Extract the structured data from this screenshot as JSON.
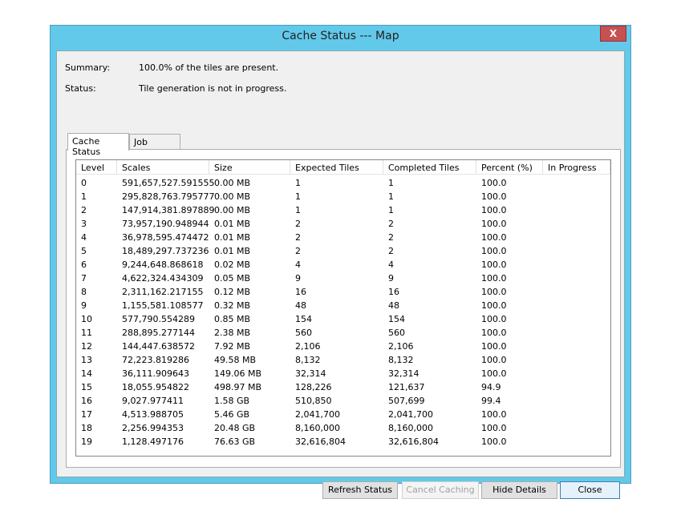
{
  "window": {
    "title": "Cache Status --- Map",
    "close_label": "X"
  },
  "summary": {
    "label": "Summary:",
    "value": "100.0% of the tiles are present."
  },
  "status": {
    "label": "Status:",
    "value": "Tile generation is not in progress."
  },
  "tabs": [
    {
      "label": "Cache Status",
      "active": true
    },
    {
      "label": "Job Status",
      "active": false
    }
  ],
  "table": {
    "columns": [
      "Level",
      "Scales",
      "Size",
      "Expected Tiles",
      "Completed Tiles",
      "Percent (%)",
      "In Progress"
    ],
    "rows": [
      [
        "0",
        "591,657,527.591555",
        "0.00 MB",
        "1",
        "1",
        "100.0",
        ""
      ],
      [
        "1",
        "295,828,763.795777",
        "0.00 MB",
        "1",
        "1",
        "100.0",
        ""
      ],
      [
        "2",
        "147,914,381.897889",
        "0.00 MB",
        "1",
        "1",
        "100.0",
        ""
      ],
      [
        "3",
        "73,957,190.948944",
        "0.01 MB",
        "2",
        "2",
        "100.0",
        ""
      ],
      [
        "4",
        "36,978,595.474472",
        "0.01 MB",
        "2",
        "2",
        "100.0",
        ""
      ],
      [
        "5",
        "18,489,297.737236",
        "0.01 MB",
        "2",
        "2",
        "100.0",
        ""
      ],
      [
        "6",
        "9,244,648.868618",
        "0.02 MB",
        "4",
        "4",
        "100.0",
        ""
      ],
      [
        "7",
        "4,622,324.434309",
        "0.05 MB",
        "9",
        "9",
        "100.0",
        ""
      ],
      [
        "8",
        "2,311,162.217155",
        "0.12 MB",
        "16",
        "16",
        "100.0",
        ""
      ],
      [
        "9",
        "1,155,581.108577",
        "0.32 MB",
        "48",
        "48",
        "100.0",
        ""
      ],
      [
        "10",
        "577,790.554289",
        "0.85 MB",
        "154",
        "154",
        "100.0",
        ""
      ],
      [
        "11",
        "288,895.277144",
        "2.38 MB",
        "560",
        "560",
        "100.0",
        ""
      ],
      [
        "12",
        "144,447.638572",
        "7.92 MB",
        "2,106",
        "2,106",
        "100.0",
        ""
      ],
      [
        "13",
        "72,223.819286",
        "49.58 MB",
        "8,132",
        "8,132",
        "100.0",
        ""
      ],
      [
        "14",
        "36,111.909643",
        "149.06 MB",
        "32,314",
        "32,314",
        "100.0",
        ""
      ],
      [
        "15",
        "18,055.954822",
        "498.97 MB",
        "128,226",
        "121,637",
        "94.9",
        ""
      ],
      [
        "16",
        "9,027.977411",
        "1.58 GB",
        "510,850",
        "507,699",
        "99.4",
        ""
      ],
      [
        "17",
        "4,513.988705",
        "5.46 GB",
        "2,041,700",
        "2,041,700",
        "100.0",
        ""
      ],
      [
        "18",
        "2,256.994353",
        "20.48 GB",
        "8,160,000",
        "8,160,000",
        "100.0",
        ""
      ],
      [
        "19",
        "1,128.497176",
        "76.63 GB",
        "32,616,804",
        "32,616,804",
        "100.0",
        ""
      ]
    ]
  },
  "buttons": {
    "refresh": "Refresh Status",
    "cancel": "Cancel Caching",
    "hide": "Hide Details",
    "close": "Close"
  },
  "colors": {
    "titlebar": "#63c9ea",
    "close_button": "#c75050"
  }
}
